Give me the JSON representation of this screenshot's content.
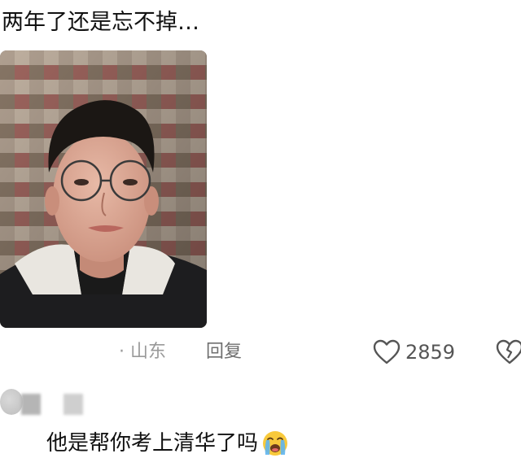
{
  "post": {
    "text": "两年了还是忘不掉…"
  },
  "comment_meta": {
    "location": "· 山东",
    "reply_label": "回复",
    "like_count": "2859",
    "like_icon": "heart-outline-icon",
    "dislike_icon": "broken-heart-icon"
  },
  "reply": {
    "text": "他是帮你考上清华了吗",
    "emoji": "loudly-crying-face"
  },
  "colors": {
    "text_primary": "#111111",
    "text_secondary": "#9a9a9a",
    "background": "#ffffff"
  }
}
